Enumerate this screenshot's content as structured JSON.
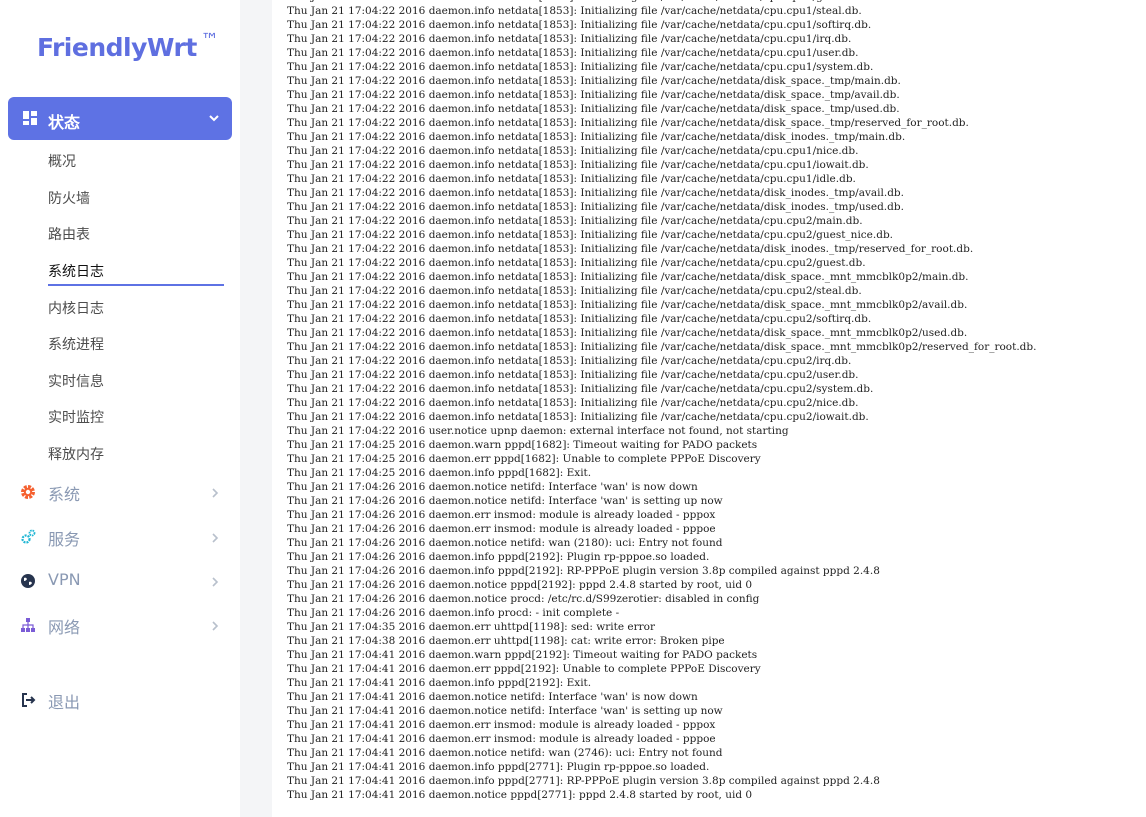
{
  "brand": {
    "name": "FriendlyWrt",
    "tm": "™"
  },
  "sidebar": {
    "status_menu": {
      "label": "状态",
      "icon": "dashboard-grid-icon"
    },
    "status_items": [
      {
        "label": "概况"
      },
      {
        "label": "防火墙"
      },
      {
        "label": "路由表"
      },
      {
        "label": "系统日志",
        "active": true
      },
      {
        "label": "内核日志"
      },
      {
        "label": "系统进程"
      },
      {
        "label": "实时信息"
      },
      {
        "label": "实时监控"
      },
      {
        "label": "释放内存"
      }
    ],
    "menus": [
      {
        "label": "系统",
        "icon": "gear-icon",
        "color": "#f5602f"
      },
      {
        "label": "服务",
        "icon": "cogs-icon",
        "color": "#1fb6d4"
      },
      {
        "label": "VPN",
        "icon": "globe-icon",
        "color": "#27344e"
      },
      {
        "label": "网络",
        "icon": "network-icon",
        "color": "#7b5cd6"
      }
    ],
    "logout": {
      "label": "退出",
      "icon": "logout-icon"
    }
  },
  "colors": {
    "accent": "#5e72e4",
    "menu_text": "#8a99b3"
  },
  "log": {
    "lines": [
      "Thu Jan 21 17:04:22 2016 daemon.info netdata[1853]: Initializing file /var/cache/netdata/cpu.cpu1/guest.db.",
      "Thu Jan 21 17:04:22 2016 daemon.info netdata[1853]: Initializing file /var/cache/netdata/cpu.cpu1/steal.db.",
      "Thu Jan 21 17:04:22 2016 daemon.info netdata[1853]: Initializing file /var/cache/netdata/cpu.cpu1/softirq.db.",
      "Thu Jan 21 17:04:22 2016 daemon.info netdata[1853]: Initializing file /var/cache/netdata/cpu.cpu1/irq.db.",
      "Thu Jan 21 17:04:22 2016 daemon.info netdata[1853]: Initializing file /var/cache/netdata/cpu.cpu1/user.db.",
      "Thu Jan 21 17:04:22 2016 daemon.info netdata[1853]: Initializing file /var/cache/netdata/cpu.cpu1/system.db.",
      "Thu Jan 21 17:04:22 2016 daemon.info netdata[1853]: Initializing file /var/cache/netdata/disk_space._tmp/main.db.",
      "Thu Jan 21 17:04:22 2016 daemon.info netdata[1853]: Initializing file /var/cache/netdata/disk_space._tmp/avail.db.",
      "Thu Jan 21 17:04:22 2016 daemon.info netdata[1853]: Initializing file /var/cache/netdata/disk_space._tmp/used.db.",
      "Thu Jan 21 17:04:22 2016 daemon.info netdata[1853]: Initializing file /var/cache/netdata/disk_space._tmp/reserved_for_root.db.",
      "Thu Jan 21 17:04:22 2016 daemon.info netdata[1853]: Initializing file /var/cache/netdata/disk_inodes._tmp/main.db.",
      "Thu Jan 21 17:04:22 2016 daemon.info netdata[1853]: Initializing file /var/cache/netdata/cpu.cpu1/nice.db.",
      "Thu Jan 21 17:04:22 2016 daemon.info netdata[1853]: Initializing file /var/cache/netdata/cpu.cpu1/iowait.db.",
      "Thu Jan 21 17:04:22 2016 daemon.info netdata[1853]: Initializing file /var/cache/netdata/cpu.cpu1/idle.db.",
      "Thu Jan 21 17:04:22 2016 daemon.info netdata[1853]: Initializing file /var/cache/netdata/disk_inodes._tmp/avail.db.",
      "Thu Jan 21 17:04:22 2016 daemon.info netdata[1853]: Initializing file /var/cache/netdata/disk_inodes._tmp/used.db.",
      "Thu Jan 21 17:04:22 2016 daemon.info netdata[1853]: Initializing file /var/cache/netdata/cpu.cpu2/main.db.",
      "Thu Jan 21 17:04:22 2016 daemon.info netdata[1853]: Initializing file /var/cache/netdata/cpu.cpu2/guest_nice.db.",
      "Thu Jan 21 17:04:22 2016 daemon.info netdata[1853]: Initializing file /var/cache/netdata/disk_inodes._tmp/reserved_for_root.db.",
      "Thu Jan 21 17:04:22 2016 daemon.info netdata[1853]: Initializing file /var/cache/netdata/cpu.cpu2/guest.db.",
      "Thu Jan 21 17:04:22 2016 daemon.info netdata[1853]: Initializing file /var/cache/netdata/disk_space._mnt_mmcblk0p2/main.db.",
      "Thu Jan 21 17:04:22 2016 daemon.info netdata[1853]: Initializing file /var/cache/netdata/cpu.cpu2/steal.db.",
      "Thu Jan 21 17:04:22 2016 daemon.info netdata[1853]: Initializing file /var/cache/netdata/disk_space._mnt_mmcblk0p2/avail.db.",
      "Thu Jan 21 17:04:22 2016 daemon.info netdata[1853]: Initializing file /var/cache/netdata/cpu.cpu2/softirq.db.",
      "Thu Jan 21 17:04:22 2016 daemon.info netdata[1853]: Initializing file /var/cache/netdata/disk_space._mnt_mmcblk0p2/used.db.",
      "Thu Jan 21 17:04:22 2016 daemon.info netdata[1853]: Initializing file /var/cache/netdata/disk_space._mnt_mmcblk0p2/reserved_for_root.db.",
      "Thu Jan 21 17:04:22 2016 daemon.info netdata[1853]: Initializing file /var/cache/netdata/cpu.cpu2/irq.db.",
      "Thu Jan 21 17:04:22 2016 daemon.info netdata[1853]: Initializing file /var/cache/netdata/cpu.cpu2/user.db.",
      "Thu Jan 21 17:04:22 2016 daemon.info netdata[1853]: Initializing file /var/cache/netdata/cpu.cpu2/system.db.",
      "Thu Jan 21 17:04:22 2016 daemon.info netdata[1853]: Initializing file /var/cache/netdata/cpu.cpu2/nice.db.",
      "Thu Jan 21 17:04:22 2016 daemon.info netdata[1853]: Initializing file /var/cache/netdata/cpu.cpu2/iowait.db.",
      "Thu Jan 21 17:04:22 2016 user.notice upnp daemon: external interface not found, not starting",
      "Thu Jan 21 17:04:25 2016 daemon.warn pppd[1682]: Timeout waiting for PADO packets",
      "Thu Jan 21 17:04:25 2016 daemon.err pppd[1682]: Unable to complete PPPoE Discovery",
      "Thu Jan 21 17:04:25 2016 daemon.info pppd[1682]: Exit.",
      "Thu Jan 21 17:04:26 2016 daemon.notice netifd: Interface 'wan' is now down",
      "Thu Jan 21 17:04:26 2016 daemon.notice netifd: Interface 'wan' is setting up now",
      "Thu Jan 21 17:04:26 2016 daemon.err insmod: module is already loaded - pppox",
      "Thu Jan 21 17:04:26 2016 daemon.err insmod: module is already loaded - pppoe",
      "Thu Jan 21 17:04:26 2016 daemon.notice netifd: wan (2180): uci: Entry not found",
      "Thu Jan 21 17:04:26 2016 daemon.info pppd[2192]: Plugin rp-pppoe.so loaded.",
      "Thu Jan 21 17:04:26 2016 daemon.info pppd[2192]: RP-PPPoE plugin version 3.8p compiled against pppd 2.4.8",
      "Thu Jan 21 17:04:26 2016 daemon.notice pppd[2192]: pppd 2.4.8 started by root, uid 0",
      "Thu Jan 21 17:04:26 2016 daemon.notice procd: /etc/rc.d/S99zerotier: disabled in config",
      "Thu Jan 21 17:04:26 2016 daemon.info procd: - init complete -",
      "Thu Jan 21 17:04:35 2016 daemon.err uhttpd[1198]: sed: write error",
      "Thu Jan 21 17:04:38 2016 daemon.err uhttpd[1198]: cat: write error: Broken pipe",
      "Thu Jan 21 17:04:41 2016 daemon.warn pppd[2192]: Timeout waiting for PADO packets",
      "Thu Jan 21 17:04:41 2016 daemon.err pppd[2192]: Unable to complete PPPoE Discovery",
      "Thu Jan 21 17:04:41 2016 daemon.info pppd[2192]: Exit.",
      "Thu Jan 21 17:04:41 2016 daemon.notice netifd: Interface 'wan' is now down",
      "Thu Jan 21 17:04:41 2016 daemon.notice netifd: Interface 'wan' is setting up now",
      "Thu Jan 21 17:04:41 2016 daemon.err insmod: module is already loaded - pppox",
      "Thu Jan 21 17:04:41 2016 daemon.err insmod: module is already loaded - pppoe",
      "Thu Jan 21 17:04:41 2016 daemon.notice netifd: wan (2746): uci: Entry not found",
      "Thu Jan 21 17:04:41 2016 daemon.info pppd[2771]: Plugin rp-pppoe.so loaded.",
      "Thu Jan 21 17:04:41 2016 daemon.info pppd[2771]: RP-PPPoE plugin version 3.8p compiled against pppd 2.4.8",
      "Thu Jan 21 17:04:41 2016 daemon.notice pppd[2771]: pppd 2.4.8 started by root, uid 0"
    ]
  }
}
